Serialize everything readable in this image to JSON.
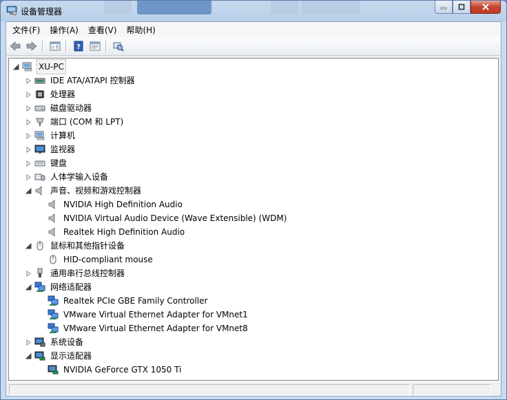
{
  "window": {
    "title": "设备管理器"
  },
  "menu": [
    "文件(F)",
    "操作(A)",
    "查看(V)",
    "帮助(H)"
  ],
  "toolbar": [
    "back-arrow-icon",
    "forward-arrow-icon",
    "properties-icon",
    "help-icon",
    "details-icon",
    "scan-hardware-icon"
  ],
  "tree": [
    {
      "label": "XU-PC",
      "level": 0,
      "state": "expanded",
      "icon": "computer-icon"
    },
    {
      "label": "IDE ATA/ATAPI 控制器",
      "level": 1,
      "state": "collapsed",
      "icon": "ide-controller-icon"
    },
    {
      "label": "处理器",
      "level": 1,
      "state": "collapsed",
      "icon": "processor-icon"
    },
    {
      "label": "磁盘驱动器",
      "level": 1,
      "state": "collapsed",
      "icon": "disk-drive-icon"
    },
    {
      "label": "端口 (COM 和 LPT)",
      "level": 1,
      "state": "collapsed",
      "icon": "port-icon"
    },
    {
      "label": "计算机",
      "level": 1,
      "state": "collapsed",
      "icon": "computer-icon"
    },
    {
      "label": "监视器",
      "level": 1,
      "state": "collapsed",
      "icon": "monitor-icon"
    },
    {
      "label": "键盘",
      "level": 1,
      "state": "collapsed",
      "icon": "keyboard-icon"
    },
    {
      "label": "人体学输入设备",
      "level": 1,
      "state": "collapsed",
      "icon": "hid-icon"
    },
    {
      "label": "声音、视频和游戏控制器",
      "level": 1,
      "state": "expanded",
      "icon": "speaker-icon"
    },
    {
      "label": "NVIDIA High Definition Audio",
      "level": 2,
      "state": "leaf",
      "icon": "speaker-icon"
    },
    {
      "label": "NVIDIA Virtual Audio Device (Wave Extensible) (WDM)",
      "level": 2,
      "state": "leaf",
      "icon": "speaker-icon"
    },
    {
      "label": "Realtek High Definition Audio",
      "level": 2,
      "state": "leaf",
      "icon": "speaker-icon"
    },
    {
      "label": "鼠标和其他指针设备",
      "level": 1,
      "state": "expanded",
      "icon": "mouse-icon"
    },
    {
      "label": "HID-compliant mouse",
      "level": 2,
      "state": "leaf",
      "icon": "mouse-icon"
    },
    {
      "label": "通用串行总线控制器",
      "level": 1,
      "state": "collapsed",
      "icon": "usb-icon"
    },
    {
      "label": "网络适配器",
      "level": 1,
      "state": "expanded",
      "icon": "network-adapter-icon"
    },
    {
      "label": "Realtek PCIe GBE Family Controller",
      "level": 2,
      "state": "leaf",
      "icon": "network-adapter-icon"
    },
    {
      "label": "VMware Virtual Ethernet Adapter for VMnet1",
      "level": 2,
      "state": "leaf",
      "icon": "network-adapter-icon"
    },
    {
      "label": "VMware Virtual Ethernet Adapter for VMnet8",
      "level": 2,
      "state": "leaf",
      "icon": "network-adapter-icon"
    },
    {
      "label": "系统设备",
      "level": 1,
      "state": "collapsed",
      "icon": "system-device-icon"
    },
    {
      "label": "显示适配器",
      "level": 1,
      "state": "expanded",
      "icon": "display-adapter-icon"
    },
    {
      "label": "NVIDIA GeForce GTX 1050 Ti",
      "level": 2,
      "state": "leaf",
      "icon": "display-adapter-icon"
    }
  ]
}
